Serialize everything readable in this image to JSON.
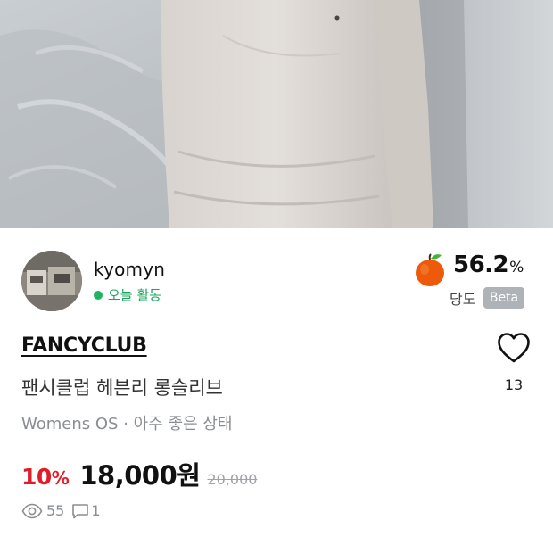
{
  "seller": {
    "username": "kyomyn",
    "activity": "오늘 활동",
    "sweetness": {
      "value": "56.2",
      "unit": "%",
      "label": "당도",
      "badge": "Beta"
    }
  },
  "product": {
    "brand": "FANCYCLUB",
    "title": "팬시클럽 헤븐리 롱슬리브",
    "details": "Womens OS · 아주 좋은 상태",
    "discount": "10",
    "discount_unit": "%",
    "price": "18,000원",
    "original_price": "20,000"
  },
  "like": {
    "count": "13"
  },
  "stats": {
    "views": "55",
    "chats": "1"
  },
  "icons": {
    "apple": "apple-icon",
    "heart": "heart-icon",
    "views": "eye-icon",
    "chats": "chat-bubble-icon"
  },
  "colors": {
    "discount": "#e01e2a",
    "activity": "#1fb463",
    "beta_badge": "#aeb3b8"
  }
}
